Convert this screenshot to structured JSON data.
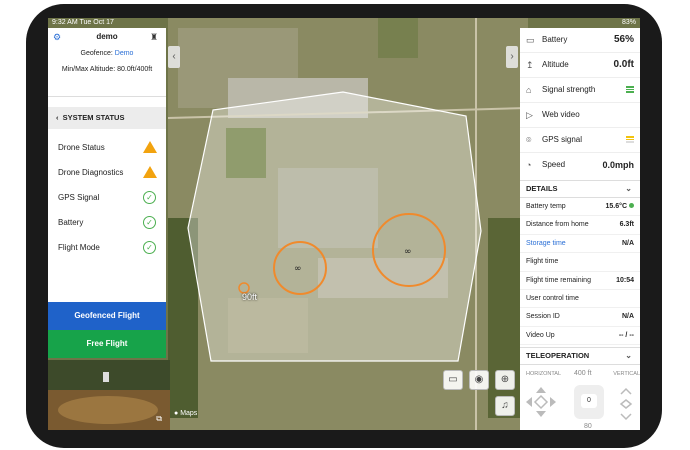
{
  "status_bar": {
    "time": "9:32 AM",
    "date": "Tue Oct 17",
    "battery": "83%"
  },
  "left_panel": {
    "title": "demo",
    "geofence_label": "Geofence:",
    "geofence_value": "Demo",
    "altitude_label": "Min/Max Altitude:",
    "altitude_value": "80.0ft/400ft",
    "section_title": "SYSTEM STATUS",
    "rows": [
      {
        "label": "Drone Status",
        "state": "warning"
      },
      {
        "label": "Drone Diagnostics",
        "state": "warning"
      },
      {
        "label": "GPS Signal",
        "state": "ok"
      },
      {
        "label": "Battery",
        "state": "ok"
      },
      {
        "label": "Flight Mode",
        "state": "ok"
      }
    ],
    "geofenced_button": "Geofenced Flight",
    "free_button": "Free Flight"
  },
  "map": {
    "marker_label": "90ft",
    "maps_credit": "Maps"
  },
  "right_panel": {
    "metrics": [
      {
        "label": "Battery",
        "value": "56%",
        "icon": "battery-icon"
      },
      {
        "label": "Altitude",
        "value": "0.0ft",
        "icon": "altitude-icon"
      },
      {
        "label": "Signal strength",
        "value": "",
        "icon": "signal-icon"
      },
      {
        "label": "Web video",
        "value": "",
        "icon": "play-icon"
      },
      {
        "label": "GPS signal",
        "value": "",
        "icon": "gps-icon"
      },
      {
        "label": "Speed",
        "value": "0.0mph",
        "icon": "speed-icon"
      }
    ],
    "details_title": "DETAILS",
    "details": [
      {
        "label": "Battery temp",
        "value": "15.6°C"
      },
      {
        "label": "Distance from home",
        "value": "6.3ft"
      },
      {
        "label": "Storage time",
        "value": "N/A"
      },
      {
        "label": "Flight time",
        "value": ""
      },
      {
        "label": "Flight time remaining",
        "value": "10:54"
      },
      {
        "label": "User control time",
        "value": ""
      },
      {
        "label": "Session ID",
        "value": "N/A"
      },
      {
        "label": "Video Up",
        "value": "-- / --"
      }
    ],
    "teleop_title": "TELEOPERATION",
    "horizontal_label": "HORIZONTAL",
    "vertical_label": "VERTICAL",
    "alt_max": "400 ft",
    "alt_value": "0",
    "alt_min": "80"
  },
  "colors": {
    "primary": "#1f62c9",
    "success": "#17a34a",
    "warning": "#f2a30f",
    "geofence_circle": "#f08a2c"
  }
}
